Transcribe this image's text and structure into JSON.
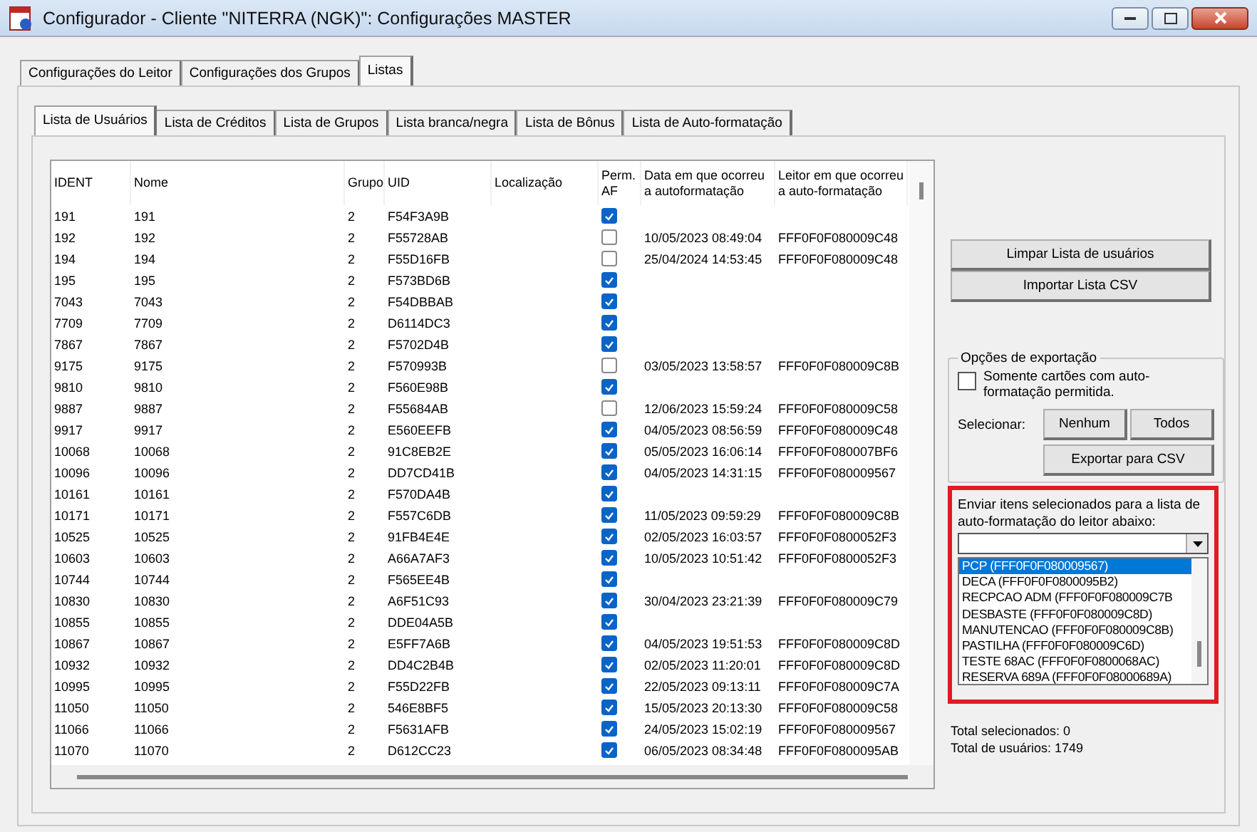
{
  "window": {
    "title": "Configurador - Cliente \"NITERRA (NGK)\": Configurações MASTER"
  },
  "tabs": [
    {
      "label": "Configurações do Leitor",
      "selected": false
    },
    {
      "label": "Configurações dos Grupos",
      "selected": false
    },
    {
      "label": "Listas",
      "selected": true
    }
  ],
  "subtabs": [
    {
      "label": "Lista de Usuários",
      "selected": true
    },
    {
      "label": "Lista de Créditos",
      "selected": false
    },
    {
      "label": "Lista de Grupos",
      "selected": false
    },
    {
      "label": "Lista branca/negra",
      "selected": false
    },
    {
      "label": "Lista de Bônus",
      "selected": false
    },
    {
      "label": "Lista de Auto-formatação",
      "selected": false
    }
  ],
  "table": {
    "columns": [
      "IDENT",
      "Nome",
      "Grupo",
      "UID",
      "Localização",
      "Perm. AF",
      "Data em que ocorreu a autoformatação",
      "Leitor em que ocorreu a auto-formatação"
    ],
    "rows": [
      {
        "ident": "191",
        "name": "191",
        "group": "2",
        "uid": "F54F3A9B",
        "perm_af": true
      },
      {
        "ident": "192",
        "name": "192",
        "group": "2",
        "uid": "F55728AB",
        "perm_af": false,
        "date": "10/05/2023 08:49:04",
        "reader": "FFF0F0F080009C48"
      },
      {
        "ident": "194",
        "name": "194",
        "group": "2",
        "uid": "F55D16FB",
        "perm_af": false,
        "date": "25/04/2024 14:53:45",
        "reader": "FFF0F0F080009C48"
      },
      {
        "ident": "195",
        "name": "195",
        "group": "2",
        "uid": "F573BD6B",
        "perm_af": true
      },
      {
        "ident": "7043",
        "name": "7043",
        "group": "2",
        "uid": "F54DBBAB",
        "perm_af": true
      },
      {
        "ident": "7709",
        "name": "7709",
        "group": "2",
        "uid": "D6114DC3",
        "perm_af": true
      },
      {
        "ident": "7867",
        "name": "7867",
        "group": "2",
        "uid": "F5702D4B",
        "perm_af": true
      },
      {
        "ident": "9175",
        "name": "9175",
        "group": "2",
        "uid": "F570993B",
        "perm_af": false,
        "date": "03/05/2023 13:58:57",
        "reader": "FFF0F0F080009C8B"
      },
      {
        "ident": "9810",
        "name": "9810",
        "group": "2",
        "uid": "F560E98B",
        "perm_af": true
      },
      {
        "ident": "9887",
        "name": "9887",
        "group": "2",
        "uid": "F55684AB",
        "perm_af": false,
        "date": "12/06/2023 15:59:24",
        "reader": "FFF0F0F080009C58"
      },
      {
        "ident": "9917",
        "name": "9917",
        "group": "2",
        "uid": "E560EEFB",
        "perm_af": true,
        "date": "04/05/2023 08:56:59",
        "reader": "FFF0F0F080009C48"
      },
      {
        "ident": "10068",
        "name": "10068",
        "group": "2",
        "uid": "91C8EB2E",
        "perm_af": true,
        "date": "05/05/2023 16:06:14",
        "reader": "FFF0F0F080007BF6"
      },
      {
        "ident": "10096",
        "name": "10096",
        "group": "2",
        "uid": "DD7CD41B",
        "perm_af": true,
        "date": "04/05/2023 14:31:15",
        "reader": "FFF0F0F080009567"
      },
      {
        "ident": "10161",
        "name": "10161",
        "group": "2",
        "uid": "F570DA4B",
        "perm_af": true
      },
      {
        "ident": "10171",
        "name": "10171",
        "group": "2",
        "uid": "F557C6DB",
        "perm_af": true,
        "date": "11/05/2023 09:59:29",
        "reader": "FFF0F0F080009C8B"
      },
      {
        "ident": "10525",
        "name": "10525",
        "group": "2",
        "uid": "91FB4E4E",
        "perm_af": true,
        "date": "02/05/2023 16:03:57",
        "reader": "FFF0F0F0800052F3"
      },
      {
        "ident": "10603",
        "name": "10603",
        "group": "2",
        "uid": "A66A7AF3",
        "perm_af": true,
        "date": "10/05/2023 10:51:42",
        "reader": "FFF0F0F0800052F3"
      },
      {
        "ident": "10744",
        "name": "10744",
        "group": "2",
        "uid": "F565EE4B",
        "perm_af": true
      },
      {
        "ident": "10830",
        "name": "10830",
        "group": "2",
        "uid": "A6F51C93",
        "perm_af": true,
        "date": "30/04/2023 23:21:39",
        "reader": "FFF0F0F080009C79"
      },
      {
        "ident": "10855",
        "name": "10855",
        "group": "2",
        "uid": "DDE04A5B",
        "perm_af": true
      },
      {
        "ident": "10867",
        "name": "10867",
        "group": "2",
        "uid": "E5FF7A6B",
        "perm_af": true,
        "date": "04/05/2023 19:51:53",
        "reader": "FFF0F0F080009C8D"
      },
      {
        "ident": "10932",
        "name": "10932",
        "group": "2",
        "uid": "DD4C2B4B",
        "perm_af": true,
        "date": "02/05/2023 11:20:01",
        "reader": "FFF0F0F080009C8D"
      },
      {
        "ident": "10995",
        "name": "10995",
        "group": "2",
        "uid": "F55D22FB",
        "perm_af": true,
        "date": "22/05/2023 09:13:11",
        "reader": "FFF0F0F080009C7A"
      },
      {
        "ident": "11050",
        "name": "11050",
        "group": "2",
        "uid": "546E8BF5",
        "perm_af": true,
        "date": "15/05/2023 20:13:30",
        "reader": "FFF0F0F080009C58"
      },
      {
        "ident": "11066",
        "name": "11066",
        "group": "2",
        "uid": "F5631AFB",
        "perm_af": true,
        "date": "24/05/2023 15:02:19",
        "reader": "FFF0F0F080009567"
      },
      {
        "ident": "11070",
        "name": "11070",
        "group": "2",
        "uid": "D612CC23",
        "perm_af": true,
        "date": "06/05/2023 08:34:48",
        "reader": "FFF0F0F0800095AB"
      }
    ]
  },
  "actions": [
    "Limpar Lista de usuários",
    "Importar Lista CSV"
  ],
  "export_options": {
    "title": "Opções de exportação",
    "only_af": {
      "label": "Somente cartões com auto-formatação permitida.",
      "checked": false
    },
    "select_label": "Selecionar:",
    "select_buttons": [
      "Nenhum",
      "Todos"
    ],
    "export_button": "Exportar para CSV"
  },
  "send_panel": {
    "label": "Enviar itens selecionados para a lista de auto-formatação do leitor abaixo:",
    "readers": [
      {
        "label": "PCP (FFF0F0F080009567)",
        "selected": true
      },
      {
        "label": "DECA (FFF0F0F0800095B2)",
        "selected": false
      },
      {
        "label": "RECPCAO ADM (FFF0F0F080009C7B",
        "selected": false
      },
      {
        "label": "DESBASTE (FFF0F0F080009C8D)",
        "selected": false
      },
      {
        "label": "MANUTENCAO (FFF0F0F080009C8B)",
        "selected": false
      },
      {
        "label": "PASTILHA (FFF0F0F080009C6D)",
        "selected": false
      },
      {
        "label": "TESTE 68AC (FFF0F0F0800068AC)",
        "selected": false
      },
      {
        "label": "RESERVA 689A (FFF0F0F08000689A)",
        "selected": false
      }
    ]
  },
  "totals": [
    "Total selecionados: 0",
    "Total de usuários: 1749"
  ]
}
